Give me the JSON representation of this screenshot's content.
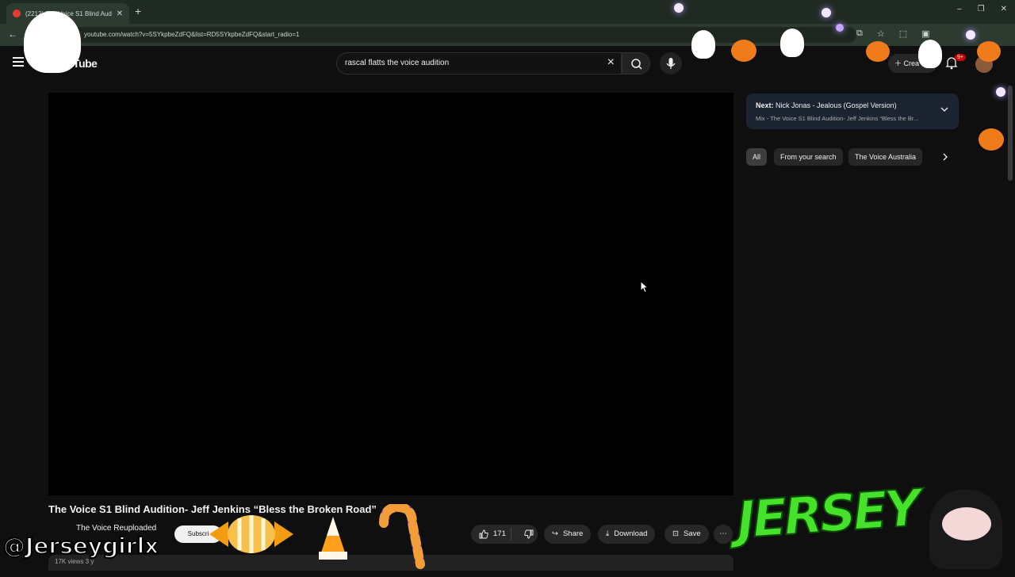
{
  "browser": {
    "tab_title": "(2212) The Voice S1 Blind Audition",
    "new_tab": "+",
    "url": "youtube.com/watch?v=5SYkpbeZdFQ&list=RD5SYkpbeZdFQ&start_radio=1",
    "window_controls": [
      "–",
      "❐",
      "✕"
    ]
  },
  "youtube": {
    "logo_text": "uTube",
    "search_value": "rascal flatts the voice audition",
    "create_label": "Crea",
    "notification_badge": "9+"
  },
  "video": {
    "title": "The Voice S1 Blind Audition- Jeff Jenkins “Bless the Broken Road”",
    "channel": "The Voice Reuploaded",
    "subscribe_label": "Subscri",
    "like_count": "171",
    "share_label": "Share",
    "download_label": "Download",
    "save_label": "Save",
    "meta": "17K views  3 y"
  },
  "sidebar": {
    "next_prefix": "Next:",
    "next_title": "Nick Jonas - Jealous (Gospel Version)",
    "next_sub": "Mix - The Voice S1 Blind Audition- Jeff Jenkins “Bless the Br...",
    "chips": [
      "All",
      "From your search",
      "The Voice Australia"
    ]
  },
  "overlay": {
    "streamer_tag": "@Jerseygirlx",
    "jersey_logo": "JERSEY"
  }
}
